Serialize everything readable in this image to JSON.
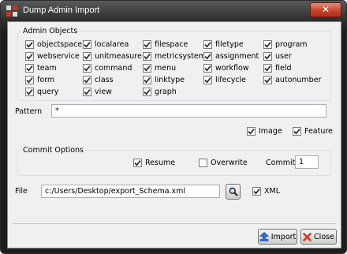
{
  "window": {
    "title": "Dump Admin Import",
    "close_glyph": "✕"
  },
  "admin_objects": {
    "legend": "Admin Objects",
    "items": [
      {
        "label": "objectspace",
        "checked": true
      },
      {
        "label": "localarea",
        "checked": true
      },
      {
        "label": "filespace",
        "checked": true
      },
      {
        "label": "filetype",
        "checked": true
      },
      {
        "label": "program",
        "checked": true
      },
      {
        "label": "webservice",
        "checked": true
      },
      {
        "label": "unitmeasure",
        "checked": true
      },
      {
        "label": "metricsystem",
        "checked": true
      },
      {
        "label": "assignment",
        "checked": true
      },
      {
        "label": "user",
        "checked": true
      },
      {
        "label": "team",
        "checked": true
      },
      {
        "label": "command",
        "checked": true
      },
      {
        "label": "menu",
        "checked": true
      },
      {
        "label": "workflow",
        "checked": true
      },
      {
        "label": "field",
        "checked": true
      },
      {
        "label": "form",
        "checked": true
      },
      {
        "label": "class",
        "checked": true
      },
      {
        "label": "linktype",
        "checked": true
      },
      {
        "label": "lifecycle",
        "checked": true
      },
      {
        "label": "autonumber",
        "checked": true
      },
      {
        "label": "query",
        "checked": true
      },
      {
        "label": "view",
        "checked": true
      },
      {
        "label": "graph",
        "checked": true
      }
    ]
  },
  "pattern": {
    "label": "Pattern",
    "value": "*"
  },
  "image_option": {
    "label": "Image",
    "checked": true
  },
  "feature_option": {
    "label": "Feature",
    "checked": true
  },
  "commit_options": {
    "legend": "Commit Options",
    "resume": {
      "label": "Resume",
      "checked": true
    },
    "overwrite": {
      "label": "Overwrite",
      "checked": false
    },
    "commit_label": "Commit",
    "commit_value": "1"
  },
  "file": {
    "label": "File",
    "value": "c:/Users/Desktop/export_Schema.xml",
    "xml": {
      "label": "XML",
      "checked": true
    }
  },
  "buttons": {
    "import": "Import",
    "close": "Close"
  },
  "colors": {
    "accent_check": "#2a2a2a",
    "import_icon": "#2f6fd6",
    "close_icon": "#d9331f"
  }
}
